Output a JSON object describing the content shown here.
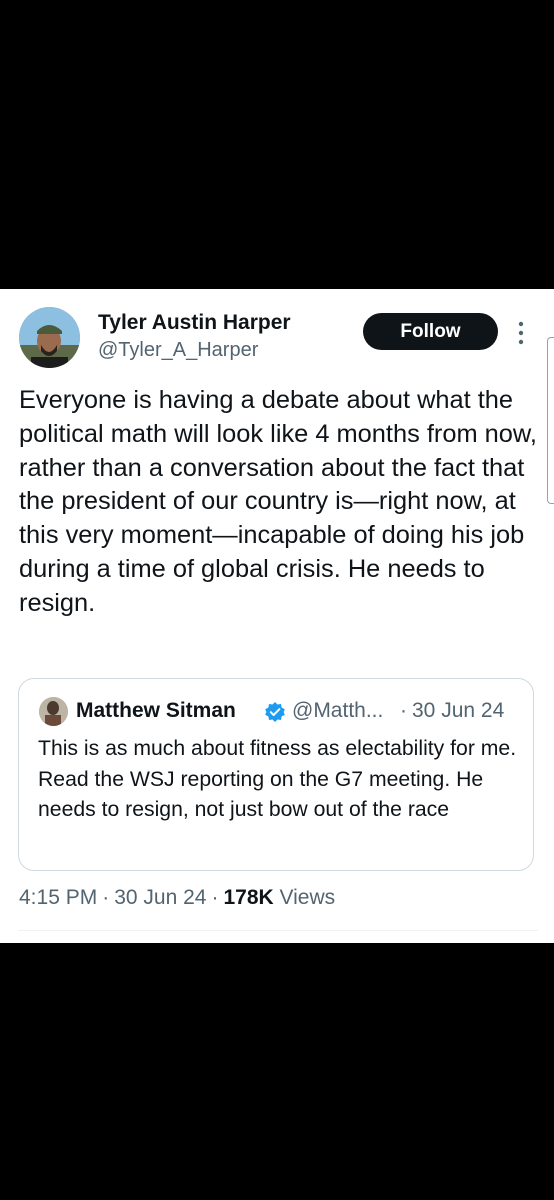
{
  "tweet": {
    "author_name": "Tyler Austin Harper",
    "author_handle": "@Tyler_A_Harper",
    "follow_label": "Follow",
    "text": "Everyone is having a debate about what the political math will look like 4 months from now, rather than a conversation about the fact that the president of our country is—right now, at this very moment—incapable of doing his job during a time of global crisis. He needs to resign.",
    "time": "4:15 PM",
    "sep1": "·",
    "date": "30 Jun 24",
    "sep2": "·",
    "views_count": "178K",
    "views_label": "Views"
  },
  "quote": {
    "author_name": "Matthew Sitman",
    "author_handle": "@Matth...",
    "sep": "·",
    "date": "30 Jun 24",
    "text": "This is as much about fitness as electability for me. Read the WSJ reporting on the G7 meeting. He needs to resign, not just bow out of the race"
  },
  "colors": {
    "verified_badge": "#1d9bf0",
    "follow_button_bg": "#0f1419",
    "secondary_text": "#536471"
  },
  "icons": [
    "more-vertical-icon",
    "verified-badge-icon"
  ]
}
